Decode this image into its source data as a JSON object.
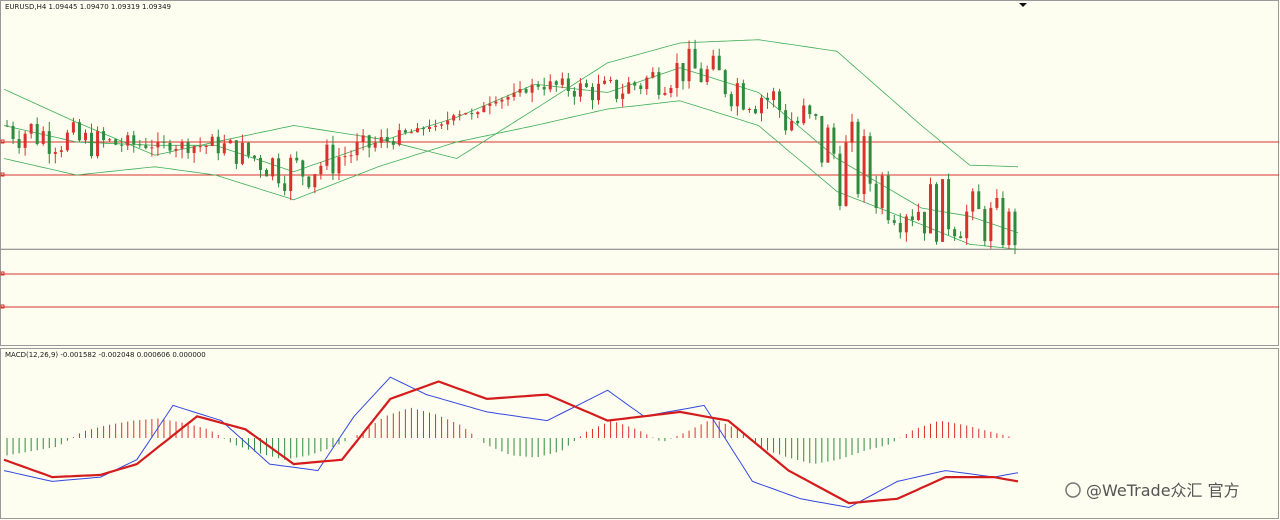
{
  "main_header": "EURUSD,H4  1.09445 1.09470 1.09319 1.09349",
  "macd_header": "MACD(12,26,9) -0.001582 -0.002048 0.000606 0.000000",
  "watermark": "@WeTrade众汇 官方",
  "colors": {
    "background": "#fdfdf0",
    "bull_candle": "#d9322c",
    "bear_candle": "#2e8b3e",
    "bollinger": "#3fae5a",
    "level_line": "#d9322c",
    "current_price_line": "#7a7a7a",
    "macd_line": "#3349e0",
    "signal_line": "#d41c1c",
    "hist_positive": "#d9322c",
    "hist_negative": "#2e8b3e"
  },
  "chart_data": [
    {
      "type": "candlestick",
      "symbol": "EURUSD",
      "timeframe": "H4",
      "last_bar": {
        "open": 1.09445,
        "high": 1.0947,
        "low": 1.09319,
        "close": 1.09349
      },
      "indicators": [
        "Bollinger Bands"
      ],
      "horizontal_levels": [
        "1.1000",
        "1.0980",
        "1.0935 (current)",
        "1.0920",
        "1.0900"
      ],
      "ylim": [
        1.088,
        1.108
      ],
      "x_bars": 168,
      "bollinger": {
        "upper": [
          [
            0,
            1.1032
          ],
          [
            12,
            1.1012
          ],
          [
            25,
            1.0992
          ],
          [
            35,
            1.1
          ],
          [
            48,
            1.101
          ],
          [
            62,
            1.1002
          ],
          [
            75,
            1.099
          ],
          [
            88,
            1.102
          ],
          [
            100,
            1.1048
          ],
          [
            112,
            1.106
          ],
          [
            125,
            1.1062
          ],
          [
            138,
            1.1055
          ],
          [
            152,
            1.101
          ],
          [
            160,
            1.0986
          ],
          [
            168,
            1.0985
          ]
        ],
        "middle": [
          [
            0,
            1.101
          ],
          [
            12,
            1.1
          ],
          [
            25,
            1.0998
          ],
          [
            35,
            1.0998
          ],
          [
            48,
            1.0982
          ],
          [
            62,
            1.1
          ],
          [
            75,
            1.1015
          ],
          [
            88,
            1.1035
          ],
          [
            100,
            1.103
          ],
          [
            112,
            1.1045
          ],
          [
            125,
            1.103
          ],
          [
            138,
            1.099
          ],
          [
            152,
            1.096
          ],
          [
            160,
            1.0955
          ],
          [
            168,
            1.0945
          ]
        ],
        "lower": [
          [
            0,
            1.099
          ],
          [
            12,
            1.098
          ],
          [
            25,
            1.0985
          ],
          [
            35,
            1.098
          ],
          [
            48,
            1.0965
          ],
          [
            62,
            1.0985
          ],
          [
            75,
            1.1
          ],
          [
            88,
            1.101
          ],
          [
            100,
            1.102
          ],
          [
            112,
            1.1025
          ],
          [
            125,
            1.101
          ],
          [
            138,
            1.097
          ],
          [
            152,
            1.095
          ],
          [
            160,
            1.0938
          ],
          [
            168,
            1.0935
          ]
        ]
      }
    },
    {
      "type": "macd",
      "params": "12,26,9",
      "values": {
        "main": -0.001582,
        "signal": -0.002048,
        "histogram": 0.000606
      },
      "ylim": [
        -0.0035,
        0.0035
      ],
      "macd_line": [
        [
          0,
          -0.0015
        ],
        [
          8,
          -0.002
        ],
        [
          16,
          -0.0018
        ],
        [
          22,
          -0.001
        ],
        [
          28,
          0.0015
        ],
        [
          36,
          0.0008
        ],
        [
          44,
          -0.0012
        ],
        [
          52,
          -0.0015
        ],
        [
          58,
          0.001
        ],
        [
          64,
          0.0028
        ],
        [
          70,
          0.002
        ],
        [
          80,
          0.0012
        ],
        [
          90,
          0.0008
        ],
        [
          100,
          0.0022
        ],
        [
          106,
          0.001
        ],
        [
          116,
          0.0015
        ],
        [
          124,
          -0.002
        ],
        [
          132,
          -0.0028
        ],
        [
          140,
          -0.0032
        ],
        [
          148,
          -0.002
        ],
        [
          156,
          -0.0015
        ],
        [
          164,
          -0.0018
        ],
        [
          168,
          -0.0016
        ]
      ],
      "signal_line": [
        [
          0,
          -0.001
        ],
        [
          8,
          -0.0018
        ],
        [
          16,
          -0.0017
        ],
        [
          22,
          -0.0012
        ],
        [
          32,
          0.001
        ],
        [
          40,
          0.0004
        ],
        [
          48,
          -0.0012
        ],
        [
          56,
          -0.001
        ],
        [
          64,
          0.0018
        ],
        [
          72,
          0.0026
        ],
        [
          80,
          0.0018
        ],
        [
          90,
          0.002
        ],
        [
          100,
          0.0008
        ],
        [
          112,
          0.0012
        ],
        [
          120,
          0.0008
        ],
        [
          130,
          -0.0015
        ],
        [
          140,
          -0.003
        ],
        [
          148,
          -0.0028
        ],
        [
          156,
          -0.0018
        ],
        [
          164,
          -0.0018
        ],
        [
          168,
          -0.002
        ]
      ],
      "histogram": [
        -0.0008,
        -0.0006,
        -0.0004,
        0.0003,
        0.0006,
        0.0008,
        0.0009,
        0.0007,
        0.0004,
        -0.0003,
        -0.0007,
        -0.001,
        -0.0008,
        -0.0004,
        0.0002,
        0.001,
        0.0014,
        0.0011,
        0.0006,
        -0.0003,
        -0.0008,
        -0.0009,
        -0.0006,
        0.0003,
        0.0008,
        0.0004,
        -0.0002,
        0.0003,
        0.0009,
        0.0004,
        -0.0005,
        -0.0009,
        -0.0012,
        -0.001,
        -0.0006,
        -0.0003,
        0.0004,
        0.0008,
        0.0006,
        0.0003,
        0.0
      ]
    }
  ]
}
